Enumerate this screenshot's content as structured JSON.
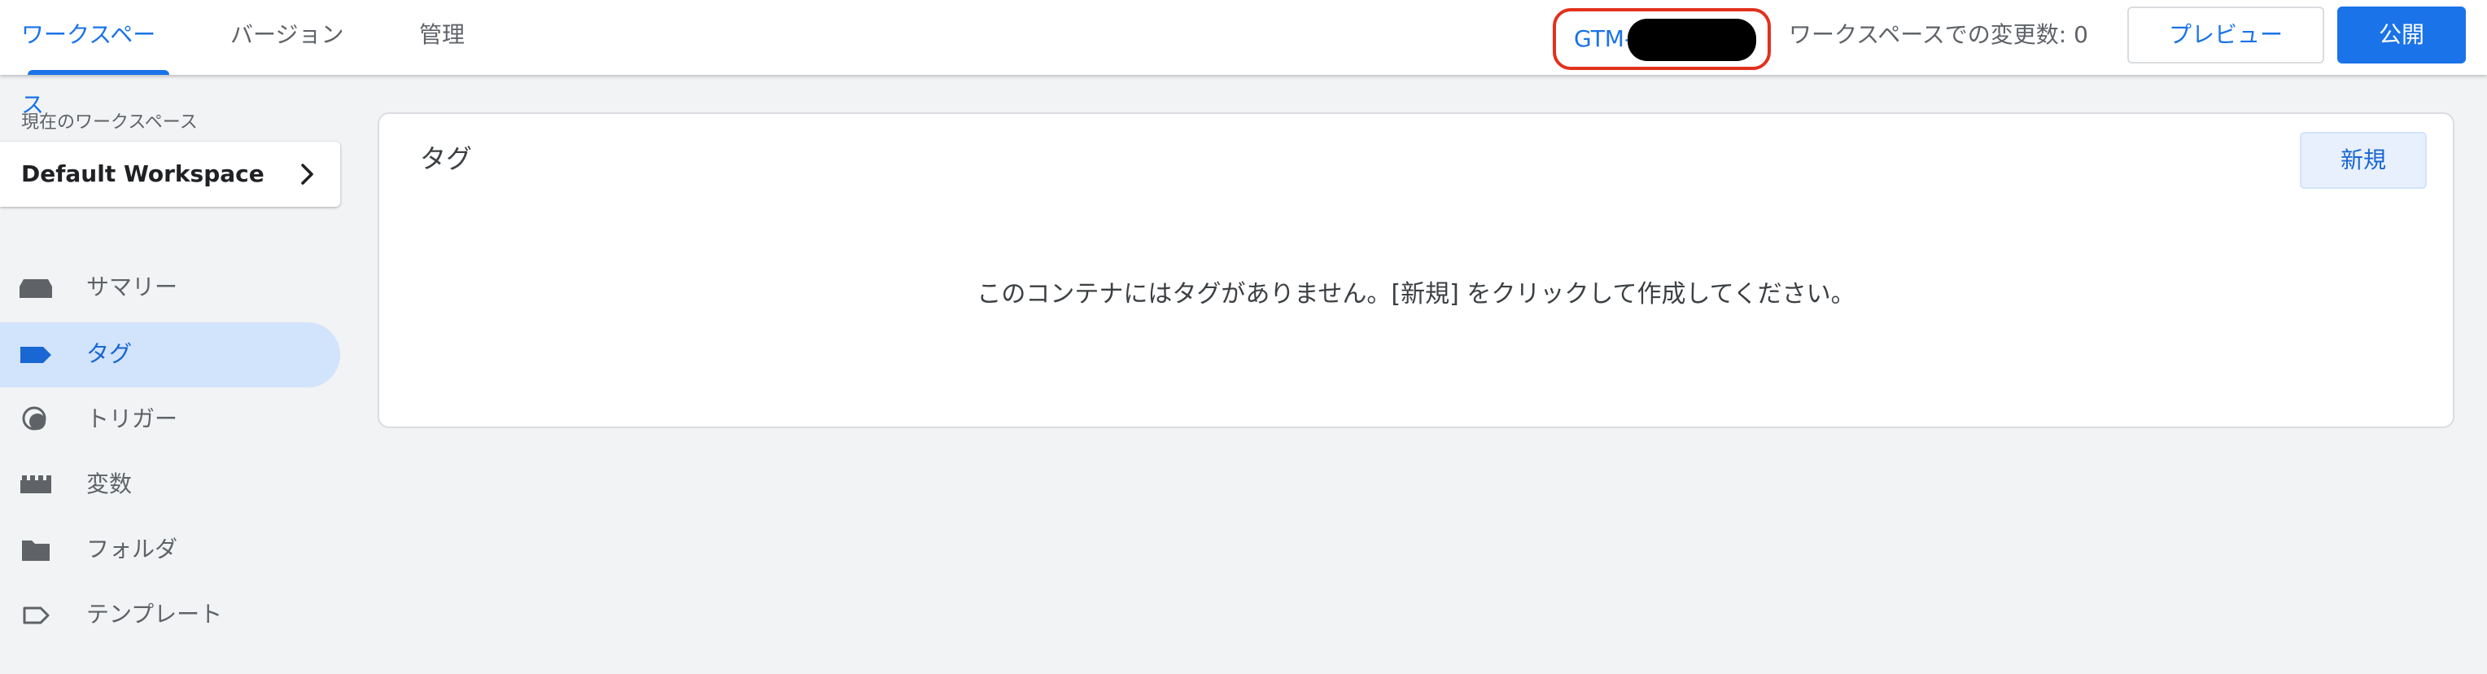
{
  "topbar": {
    "tabs": [
      {
        "label": "ワークスペース",
        "active": true
      },
      {
        "label": "バージョン",
        "active": false
      },
      {
        "label": "管理",
        "active": false
      }
    ],
    "container_id_prefix": "GTM-",
    "workspace_changes": "ワークスペースでの変更数: 0",
    "preview_label": "プレビュー",
    "publish_label": "公開"
  },
  "sidebar": {
    "current_workspace_caption": "現在のワークスペース",
    "workspace_name": "Default Workspace",
    "items": [
      {
        "label": "サマリー",
        "icon": "inbox-icon",
        "active": false
      },
      {
        "label": "タグ",
        "icon": "tag-icon",
        "active": true
      },
      {
        "label": "トリガー",
        "icon": "trigger-icon",
        "active": false
      },
      {
        "label": "変数",
        "icon": "variables-icon",
        "active": false
      },
      {
        "label": "フォルダ",
        "icon": "folder-icon",
        "active": false
      },
      {
        "label": "テンプレート",
        "icon": "template-icon",
        "active": false
      }
    ]
  },
  "main": {
    "card_title": "タグ",
    "new_button_label": "新規",
    "empty_message": "このコンテナにはタグがありません。[新規] をクリックして作成してください。"
  },
  "colors": {
    "accent": "#1a73e8",
    "active_nav_bg": "#d2e3fc",
    "highlight_outline": "#e2311d",
    "page_bg": "#f1f3f4"
  }
}
